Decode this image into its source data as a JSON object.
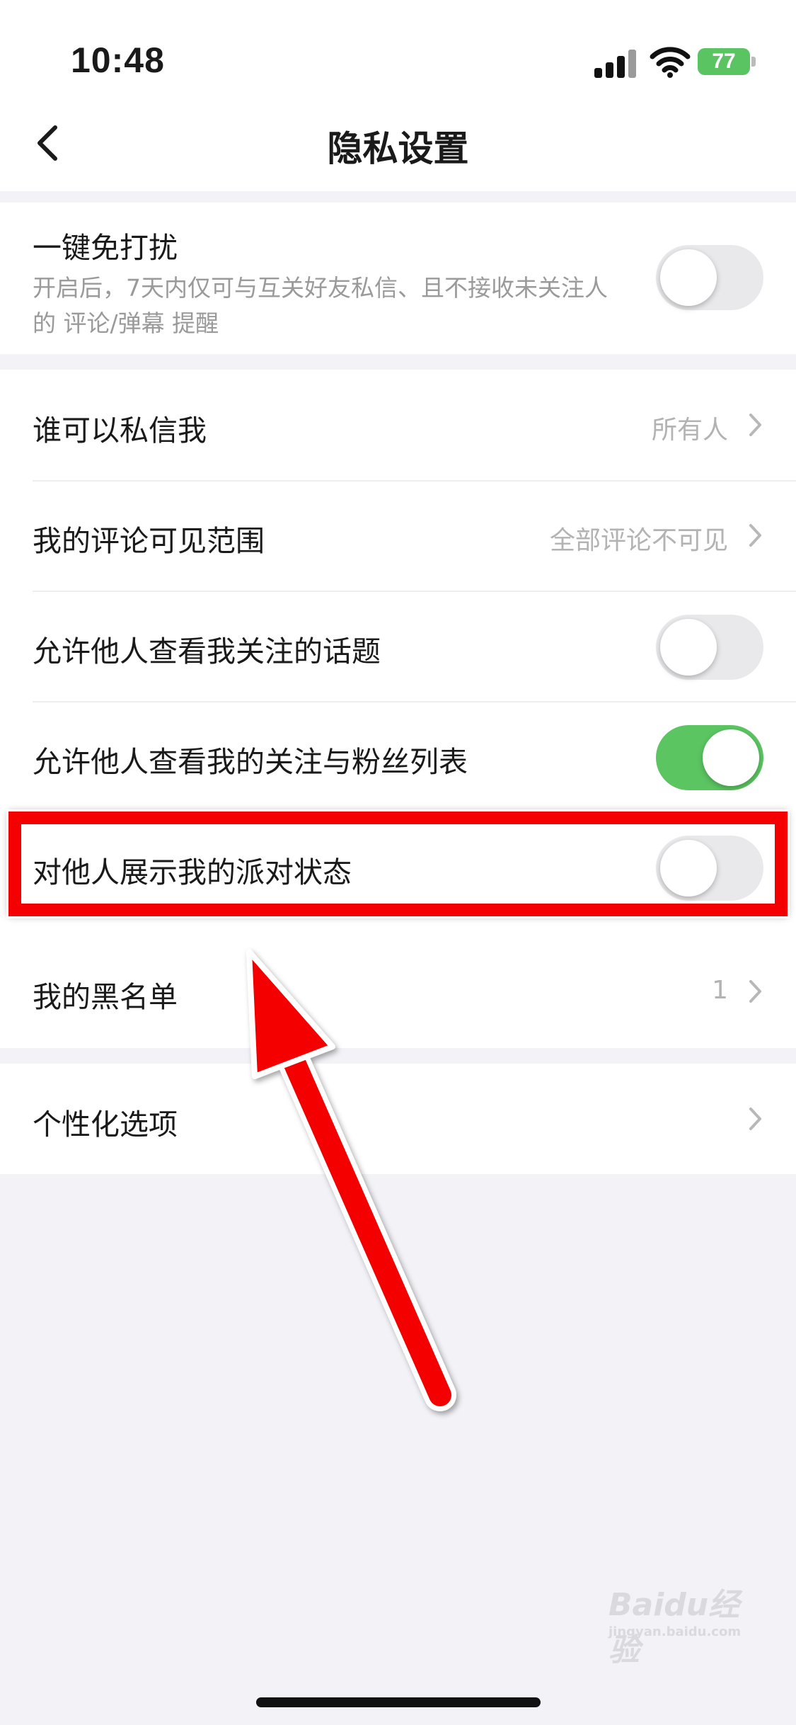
{
  "status_bar": {
    "time": "10:48",
    "battery": "77"
  },
  "nav": {
    "title": "隐私设置"
  },
  "dnd": {
    "label": "一键免打扰",
    "description": "开启后，7天内仅可与互关好友私信、且不接收未关注人的 评论/弹幕 提醒",
    "enabled": false
  },
  "settings": [
    {
      "label": "谁可以私信我",
      "value": "所有人",
      "control": "chevron"
    },
    {
      "label": "我的评论可见范围",
      "value": "全部评论不可见",
      "control": "chevron"
    },
    {
      "label": "允许他人查看我关注的话题",
      "control": "toggle",
      "enabled": false
    },
    {
      "label": "允许他人查看我的关注与粉丝列表",
      "control": "toggle",
      "enabled": true
    },
    {
      "label": "对他人展示我的派对状态",
      "control": "toggle",
      "enabled": false
    },
    {
      "label": "我的黑名单",
      "value": "1",
      "control": "chevron"
    }
  ],
  "personalization": {
    "label": "个性化选项"
  },
  "watermark": {
    "brand": "Baidu经验",
    "url": "jingyan.baidu.com"
  },
  "colors": {
    "toggle_on": "#5bc561",
    "toggle_off": "#e9e9eb",
    "highlight": "#f40000",
    "background": "#f2f2f7"
  }
}
